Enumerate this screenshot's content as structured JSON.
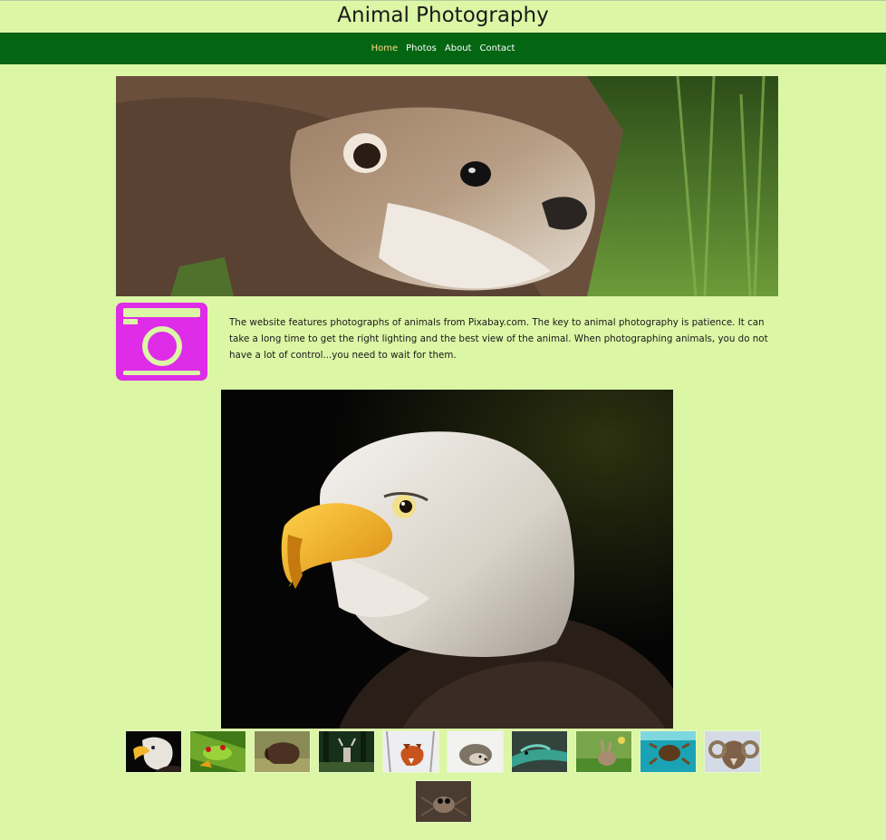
{
  "site": {
    "title": "Animal Photography"
  },
  "nav": {
    "items": [
      {
        "label": "Home",
        "active": true
      },
      {
        "label": "Photos",
        "active": false
      },
      {
        "label": "About",
        "active": false
      },
      {
        "label": "Contact",
        "active": false
      }
    ]
  },
  "intro": {
    "icon": "camera-icon",
    "text": "The website features photographs of animals from Pixabay.com. The key to animal photography is patience. It can take a long time to get the right lighting and the best view of the animal. When photographing animals, you do not have a lot of control...you need to wait for them."
  },
  "images": {
    "hero": "otter",
    "featured": "bald eagle"
  },
  "thumbnails": [
    "eagle",
    "frog",
    "bison",
    "deer",
    "fox",
    "hedgehog",
    "lizard",
    "rabbit",
    "turtle",
    "ram",
    "spider"
  ],
  "colors": {
    "page_bg": "#dbf6a5",
    "nav_bg": "#046612",
    "nav_active": "#ffd98a",
    "icon_accent": "#de2ce8"
  }
}
